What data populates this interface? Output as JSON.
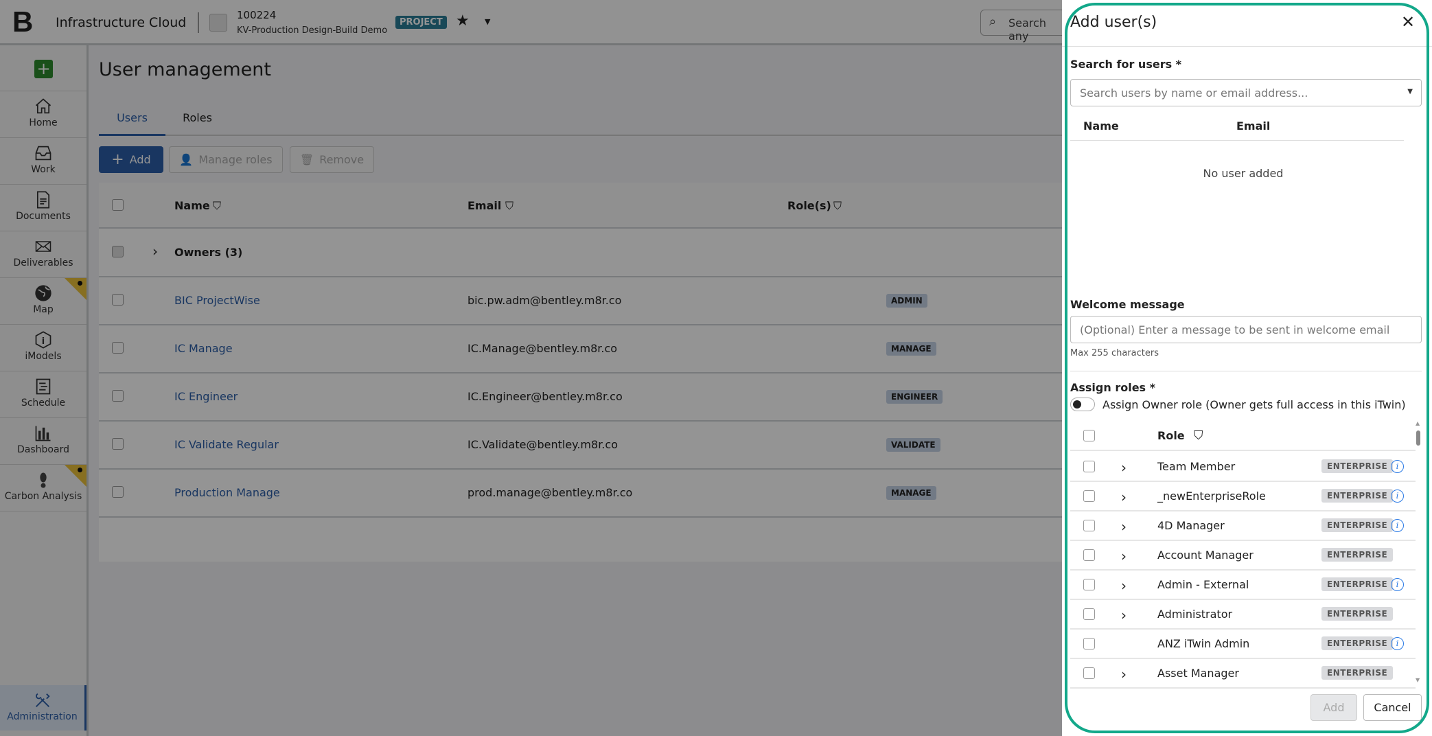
{
  "header": {
    "app_name": "Infrastructure Cloud",
    "project_number": "100224",
    "project_name": "KV-Production Design-Build Demo",
    "project_badge": "PROJECT",
    "search_placeholder": "Search any"
  },
  "sidebar": {
    "items": [
      {
        "label": "Home"
      },
      {
        "label": "Work"
      },
      {
        "label": "Documents"
      },
      {
        "label": "Deliverables"
      },
      {
        "label": "Map"
      },
      {
        "label": "iModels"
      },
      {
        "label": "Schedule"
      },
      {
        "label": "Dashboard"
      },
      {
        "label": "Carbon Analysis"
      }
    ],
    "admin_label": "Administration"
  },
  "page": {
    "title": "User management",
    "tabs": [
      "Users",
      "Roles"
    ],
    "toolbar": {
      "add": "Add",
      "manage_roles": "Manage roles",
      "remove": "Remove"
    }
  },
  "table": {
    "headers": {
      "name": "Name",
      "email": "Email",
      "roles": "Role(s)"
    },
    "group": "Owners (3)",
    "rows": [
      {
        "name": "BIC ProjectWise",
        "email": "bic.pw.adm@bentley.m8r.co",
        "role": "ADMIN"
      },
      {
        "name": "IC Manage",
        "email": "IC.Manage@bentley.m8r.co",
        "role": "MANAGE"
      },
      {
        "name": "IC Engineer",
        "email": "IC.Engineer@bentley.m8r.co",
        "role": "ENGINEER"
      },
      {
        "name": "IC Validate Regular",
        "email": "IC.Validate@bentley.m8r.co",
        "role": "VALIDATE"
      },
      {
        "name": "Production Manage",
        "email": "prod.manage@bentley.m8r.co",
        "role": "MANAGE"
      }
    ]
  },
  "dialog": {
    "title": "Add user(s)",
    "search_label": "Search for users *",
    "search_placeholder": "Search users by name or email address...",
    "col_name": "Name",
    "col_email": "Email",
    "empty": "No user added",
    "welcome_label": "Welcome message",
    "welcome_placeholder": "(Optional) Enter a message to be sent in welcome email",
    "welcome_hint": "Max 255 characters",
    "roles_label": "Assign roles *",
    "owner_toggle": "Assign Owner role (Owner gets full access in this iTwin)",
    "role_header": "Role",
    "roles": [
      {
        "name": "Team Member",
        "badge": "ENTERPRISE",
        "expand": true,
        "info": true
      },
      {
        "name": "_newEnterpriseRole",
        "badge": "ENTERPRISE",
        "expand": true,
        "info": true
      },
      {
        "name": "4D Manager",
        "badge": "ENTERPRISE",
        "expand": true,
        "info": true
      },
      {
        "name": "Account Manager",
        "badge": "ENTERPRISE",
        "expand": true,
        "info": false
      },
      {
        "name": "Admin - External",
        "badge": "ENTERPRISE",
        "expand": true,
        "info": true
      },
      {
        "name": "Administrator",
        "badge": "ENTERPRISE",
        "expand": true,
        "info": false
      },
      {
        "name": "ANZ iTwin Admin",
        "badge": "ENTERPRISE",
        "expand": false,
        "info": true
      },
      {
        "name": "Asset Manager",
        "badge": "ENTERPRISE",
        "expand": true,
        "info": false
      }
    ],
    "add_button": "Add",
    "cancel_button": "Cancel"
  },
  "colors": {
    "accent": "#2b5ea7",
    "highlight": "#13a88a"
  }
}
